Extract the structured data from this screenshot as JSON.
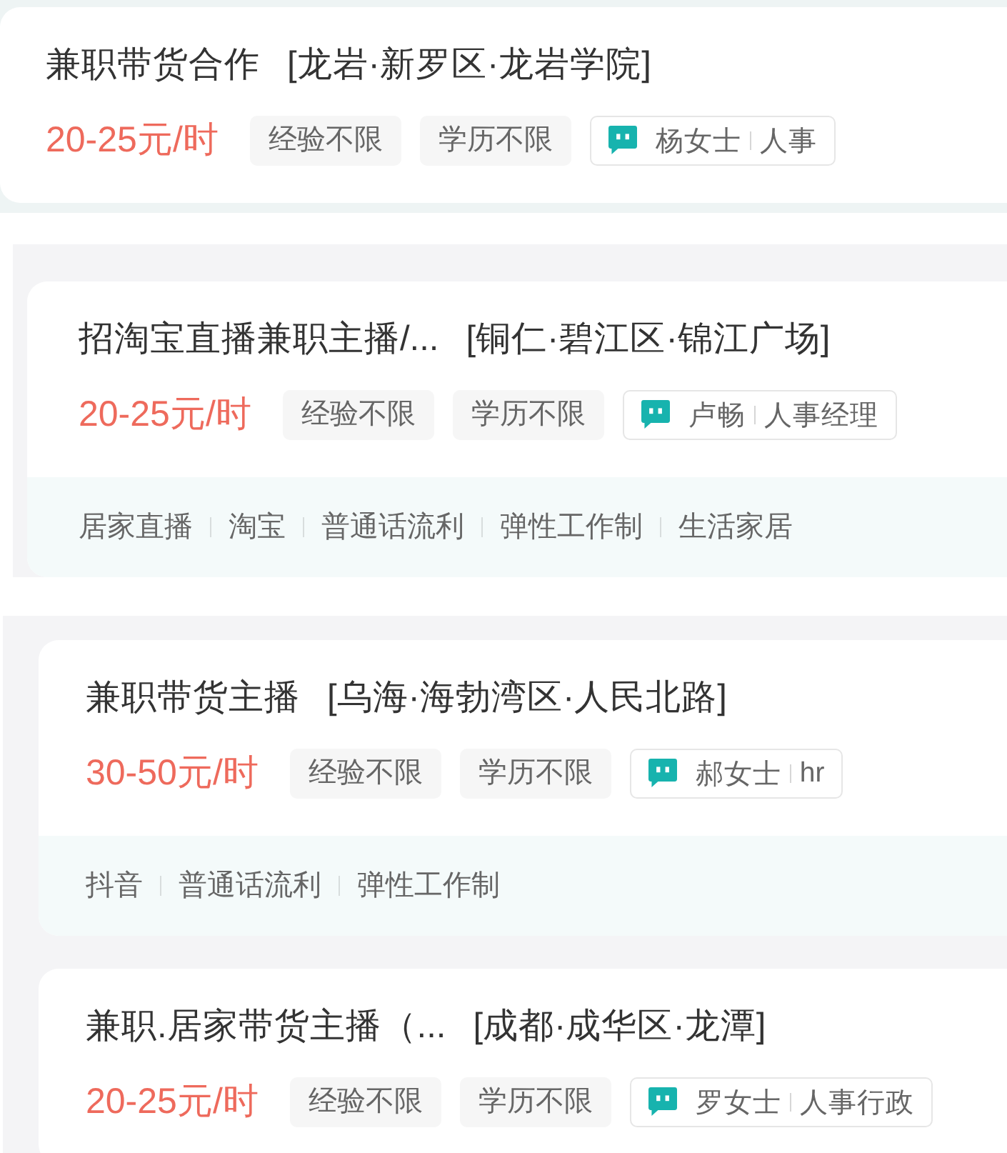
{
  "panels": [
    {
      "jobs": [
        {
          "title": "兼职带货合作",
          "location": "[龙岩·新罗区·龙岩学院]",
          "salary": "20-25元/时",
          "requirements": [
            "经验不限",
            "学历不限"
          ],
          "contact": {
            "name": "杨女士",
            "role": "人事"
          }
        }
      ]
    },
    {
      "jobs": [
        {
          "title": "招淘宝直播兼职主播/...",
          "location": "[铜仁·碧江区·锦江广场]",
          "salary": "20-25元/时",
          "requirements": [
            "经验不限",
            "学历不限"
          ],
          "contact": {
            "name": "卢畅",
            "role": "人事经理"
          },
          "tags": [
            "居家直播",
            "淘宝",
            "普通话流利",
            "弹性工作制",
            "生活家居"
          ]
        }
      ]
    },
    {
      "jobs": [
        {
          "title": "兼职带货主播",
          "location": "[乌海·海勃湾区·人民北路]",
          "salary": "30-50元/时",
          "requirements": [
            "经验不限",
            "学历不限"
          ],
          "contact": {
            "name": "郝女士",
            "role": "hr"
          },
          "tags": [
            "抖音",
            "普通话流利",
            "弹性工作制"
          ]
        },
        {
          "title": "兼职.居家带货主播（...",
          "location": "[成都·成华区·龙潭]",
          "salary": "20-25元/时",
          "requirements": [
            "经验不限",
            "学历不限"
          ],
          "contact": {
            "name": "罗女士",
            "role": "人事行政"
          }
        }
      ]
    }
  ]
}
